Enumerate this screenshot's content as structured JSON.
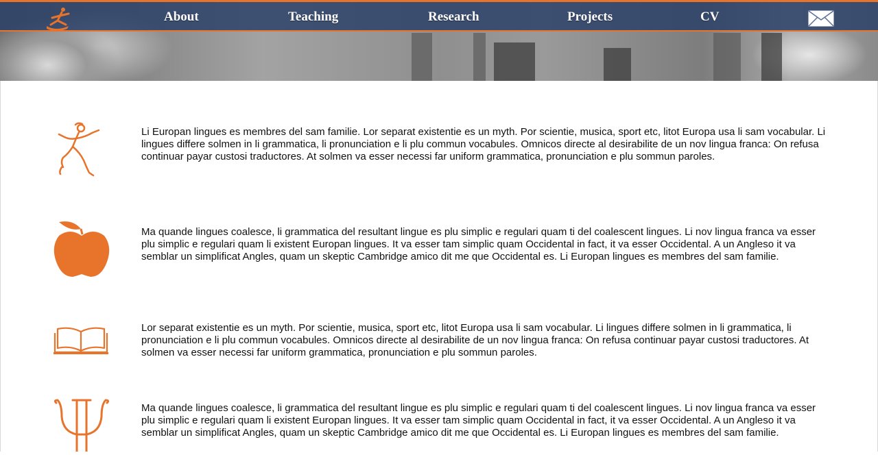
{
  "nav": {
    "items": [
      {
        "label": "About"
      },
      {
        "label": "Teaching"
      },
      {
        "label": "Research"
      },
      {
        "label": "Projects"
      },
      {
        "label": "CV"
      }
    ],
    "logo_icon": "running-figure-logo-icon",
    "mail_icon": "envelope-icon"
  },
  "colors": {
    "accent": "#e8732a",
    "nav_bg": "#283e68",
    "text": "#111111"
  },
  "sections": [
    {
      "icon": "running-figure-icon",
      "text": "Li Europan lingues es membres del sam familie. Lor separat existentie es un myth. Por scientie, musica, sport etc, litot Europa usa li sam vocabular. Li lingues differe solmen in li grammatica, li pronunciation e li plu commun vocabules. Omnicos directe al desirabilite de un nov lingua franca: On refusa continuar payar custosi traductores. At solmen va esser necessi far uniform grammatica, pronunciation e plu sommun paroles."
    },
    {
      "icon": "apple-icon",
      "text": "Ma quande lingues coalesce, li grammatica del resultant lingue es plu simplic e regulari quam ti del coalescent lingues. Li nov lingua franca va esser plu simplic e regulari quam li existent Europan lingues. It va esser tam simplic quam Occidental in fact, it va esser Occidental. A un Angleso it va semblar un simplificat Angles, quam un skeptic Cambridge amico dit me que Occidental es. Li Europan lingues es membres del sam familie."
    },
    {
      "icon": "open-book-icon",
      "text": "Lor separat existentie es un myth. Por scientie, musica, sport etc, litot Europa usa li sam vocabular. Li lingues differe solmen in li grammatica, li pronunciation e li plu commun vocabules. Omnicos directe al desirabilite de un nov lingua franca: On refusa continuar payar custosi traductores. At solmen va esser necessi far uniform grammatica, pronunciation e plu sommun paroles."
    },
    {
      "icon": "psi-icon",
      "text": "Ma quande lingues coalesce, li grammatica del resultant lingue es plu simplic e regulari quam ti del coalescent lingues. Li nov lingua franca va esser plu simplic e regulari quam li existent Europan lingues. It va esser tam simplic quam Occidental in fact, it va esser Occidental. A un Angleso it va semblar un simplificat Angles, quam un skeptic Cambridge amico dit me que Occidental es. Li Europan lingues es membres del sam familie."
    }
  ]
}
